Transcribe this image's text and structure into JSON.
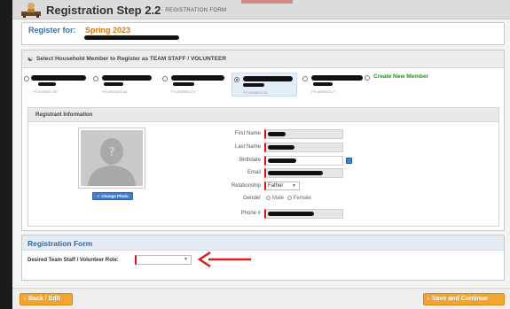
{
  "header": {
    "title": "Registration Step 2.2",
    "separator": "-",
    "subtitle": "REGISTRATION FORM"
  },
  "register_for": {
    "label": "Register for:",
    "season": "Spring 2023"
  },
  "household": {
    "section_title": "Select Household Member to Register as TEAM STAFF / VOLUNTEER",
    "members": [
      {
        "id": "PY-8059047-80",
        "selected": false
      },
      {
        "id": "PH-8059325-82",
        "selected": false
      },
      {
        "id": "PY-8059823-27",
        "selected": false
      },
      {
        "id": "PY-8059823-30",
        "selected": true
      },
      {
        "id": "PH-8059823-77",
        "selected": false
      }
    ],
    "create_new_label": "Create New Member"
  },
  "registrant": {
    "section_title": "Registrant Information",
    "change_photo_label": "Change Photo",
    "fields": {
      "first_name_label": "First Name",
      "last_name_label": "Last Name",
      "birthdate_label": "Birthdate",
      "email_label": "Email",
      "relationship_label": "Relationship",
      "relationship_value": "Father",
      "gender_label": "Gender",
      "gender_male": "Male",
      "gender_female": "Female",
      "phone_label": "Phone #"
    }
  },
  "registration_form": {
    "title": "Registration Form",
    "role_label": "Desired Team Staff / Volunteer Role:",
    "role_value": ""
  },
  "buttons": {
    "back_label": "Back / Edit",
    "save_label": "Save and Continue"
  },
  "colors": {
    "accent_orange": "#f0a530",
    "title_blue": "#2f6aa6",
    "create_green": "#2e8b2e",
    "annotation_red": "#d91c1c"
  }
}
